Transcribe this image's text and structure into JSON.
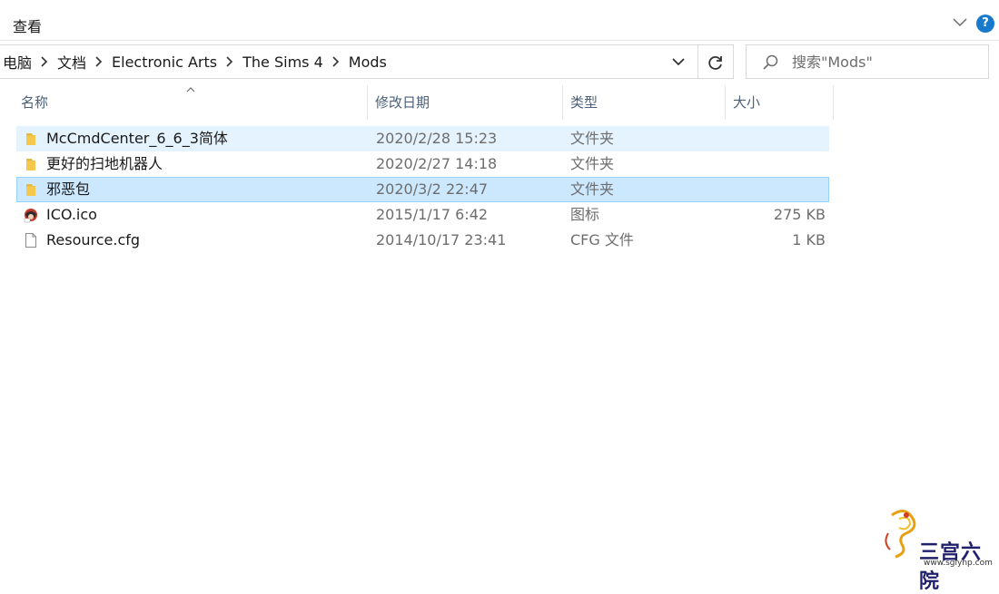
{
  "ribbon": {
    "tab_view": "查看",
    "help": "?"
  },
  "address": {
    "crumbs": [
      "电脑",
      "文档",
      "Electronic Arts",
      "The Sims 4",
      "Mods"
    ]
  },
  "search": {
    "placeholder": "搜索\"Mods\""
  },
  "columns": {
    "name": "名称",
    "date": "修改日期",
    "type": "类型",
    "size": "大小"
  },
  "files": [
    {
      "name": "McCmdCenter_6_6_3简体",
      "date": "2020/2/28 15:23",
      "type": "文件夹",
      "size": "",
      "icon": "folder-icon",
      "state": "hover"
    },
    {
      "name": "更好的扫地机器人",
      "date": "2020/2/27 14:18",
      "type": "文件夹",
      "size": "",
      "icon": "folder-icon",
      "state": ""
    },
    {
      "name": "邪恶包",
      "date": "2020/3/2 22:47",
      "type": "文件夹",
      "size": "",
      "icon": "folder-icon",
      "state": "selected"
    },
    {
      "name": "ICO.ico",
      "date": "2015/1/17 6:42",
      "type": "图标",
      "size": "275 KB",
      "icon": "ico-file-icon",
      "state": ""
    },
    {
      "name": "Resource.cfg",
      "date": "2014/10/17 23:41",
      "type": "CFG 文件",
      "size": "1 KB",
      "icon": "document-file-icon",
      "state": ""
    }
  ],
  "watermark": {
    "text": "三宫六院",
    "url": "www.sglynp.com"
  },
  "colors": {
    "accent": "#1979ca",
    "selection": "#cce8ff",
    "selection_border": "#99d1ff",
    "hover": "#e5f3ff",
    "folder": "#f4c74d"
  }
}
